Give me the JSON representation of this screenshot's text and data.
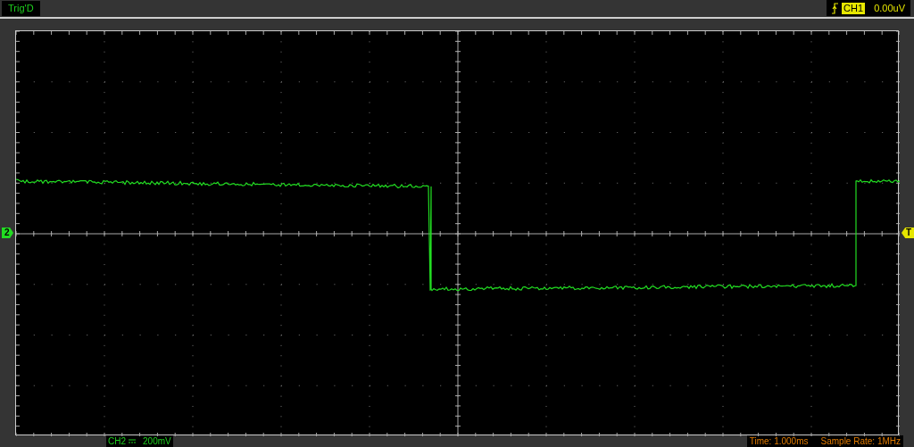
{
  "top_bar": {
    "trigger_status": "Trig'D",
    "trigger_channel": "CH1",
    "trigger_level": "0.00uV"
  },
  "markers": {
    "channel": "2",
    "trigger": "T"
  },
  "bottom_bar": {
    "channel": "CH2",
    "scale": "200mV",
    "time": "Time: 1.000ms",
    "sample_rate": "Sample Rate: 1MHz"
  }
}
